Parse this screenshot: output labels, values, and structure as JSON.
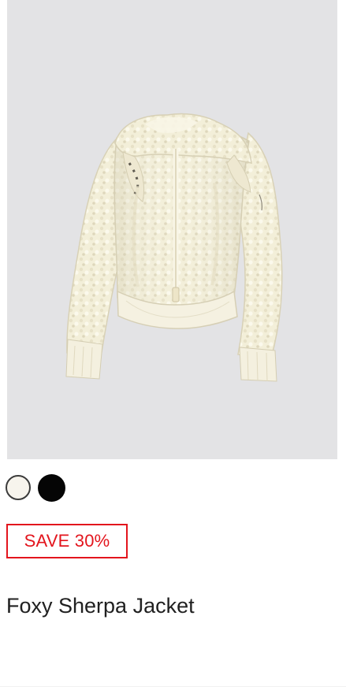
{
  "product": {
    "image_subject": "Foxy Sherpa Jacket",
    "title": "Foxy Sherpa Jacket",
    "sale_badge": "SAVE 30%",
    "swatches": [
      {
        "name": "ivory",
        "color": "#f7f4ed",
        "selected": true
      },
      {
        "name": "black",
        "color": "#050505",
        "selected": false
      }
    ],
    "colors": {
      "image_background": "#e3e3e5",
      "sale": "#e3151d",
      "text": "#202020"
    },
    "icons": {
      "swatch_ivory": "color-swatch-ivory",
      "swatch_black": "color-swatch-black",
      "product_image": "sherpa-jacket-image"
    }
  }
}
